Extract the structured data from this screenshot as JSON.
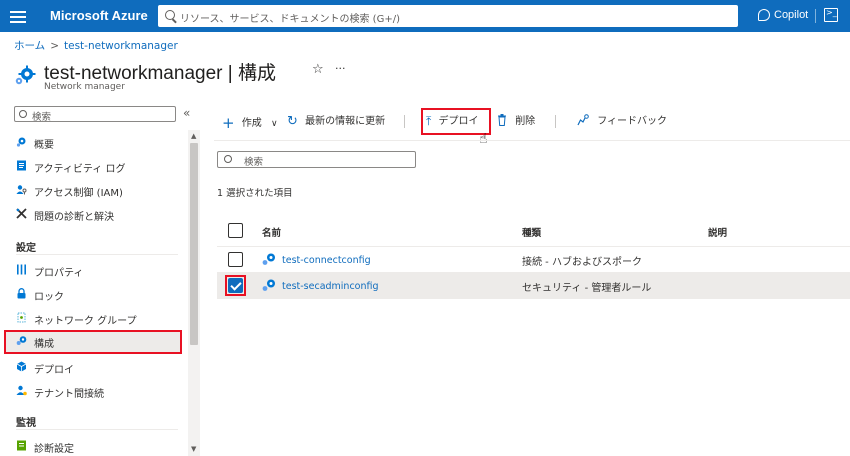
{
  "topbar": {
    "brand": "Microsoft Azure",
    "search_placeholder": "リソース、サービス、ドキュメントの検索 (G+/)",
    "copilot_label": "Copilot"
  },
  "breadcrumb": {
    "home": "ホーム",
    "current": "test-networkmanager"
  },
  "page": {
    "title": "test-networkmanager | 構成",
    "subtitle": "Network manager"
  },
  "sidebar": {
    "search_placeholder": "検索",
    "items": [
      {
        "label": "概要",
        "icon": "overview-icon"
      },
      {
        "label": "アクティビティ ログ",
        "icon": "activity-log-icon"
      },
      {
        "label": "アクセス制御 (IAM)",
        "icon": "access-control-icon"
      },
      {
        "label": "問題の診断と解決",
        "icon": "diagnose-icon"
      }
    ],
    "section_settings": "設定",
    "settings_items": [
      {
        "label": "プロパティ",
        "icon": "properties-icon"
      },
      {
        "label": "ロック",
        "icon": "lock-icon"
      },
      {
        "label": "ネットワーク グループ",
        "icon": "network-group-icon"
      },
      {
        "label": "構成",
        "icon": "configuration-icon",
        "selected": true
      },
      {
        "label": "デプロイ",
        "icon": "deploy-cube-icon"
      },
      {
        "label": "テナント間接続",
        "icon": "tenant-connection-icon"
      }
    ],
    "section_monitoring": "監視",
    "monitoring_items": [
      {
        "label": "診断設定",
        "icon": "diagnostic-settings-icon"
      }
    ]
  },
  "toolbar": {
    "create": "作成",
    "refresh": "最新の情報に更新",
    "deploy": "デプロイ",
    "delete": "削除",
    "feedback": "フィードバック"
  },
  "filter_placeholder": "検索",
  "selection_count": "1 選択された項目",
  "table": {
    "headers": {
      "name": "名前",
      "type": "種類",
      "description": "説明"
    },
    "rows": [
      {
        "name": "test-connectconfig",
        "type": "接続 - ハブおよびスポーク",
        "description": "",
        "checked": false
      },
      {
        "name": "test-secadminconfig",
        "type": "セキュリティ - 管理者ルール",
        "description": "",
        "checked": true
      }
    ]
  },
  "colors": {
    "azure_blue": "#0f6cbd",
    "highlight_red": "#e81123",
    "selected_row": "#edebe9"
  }
}
